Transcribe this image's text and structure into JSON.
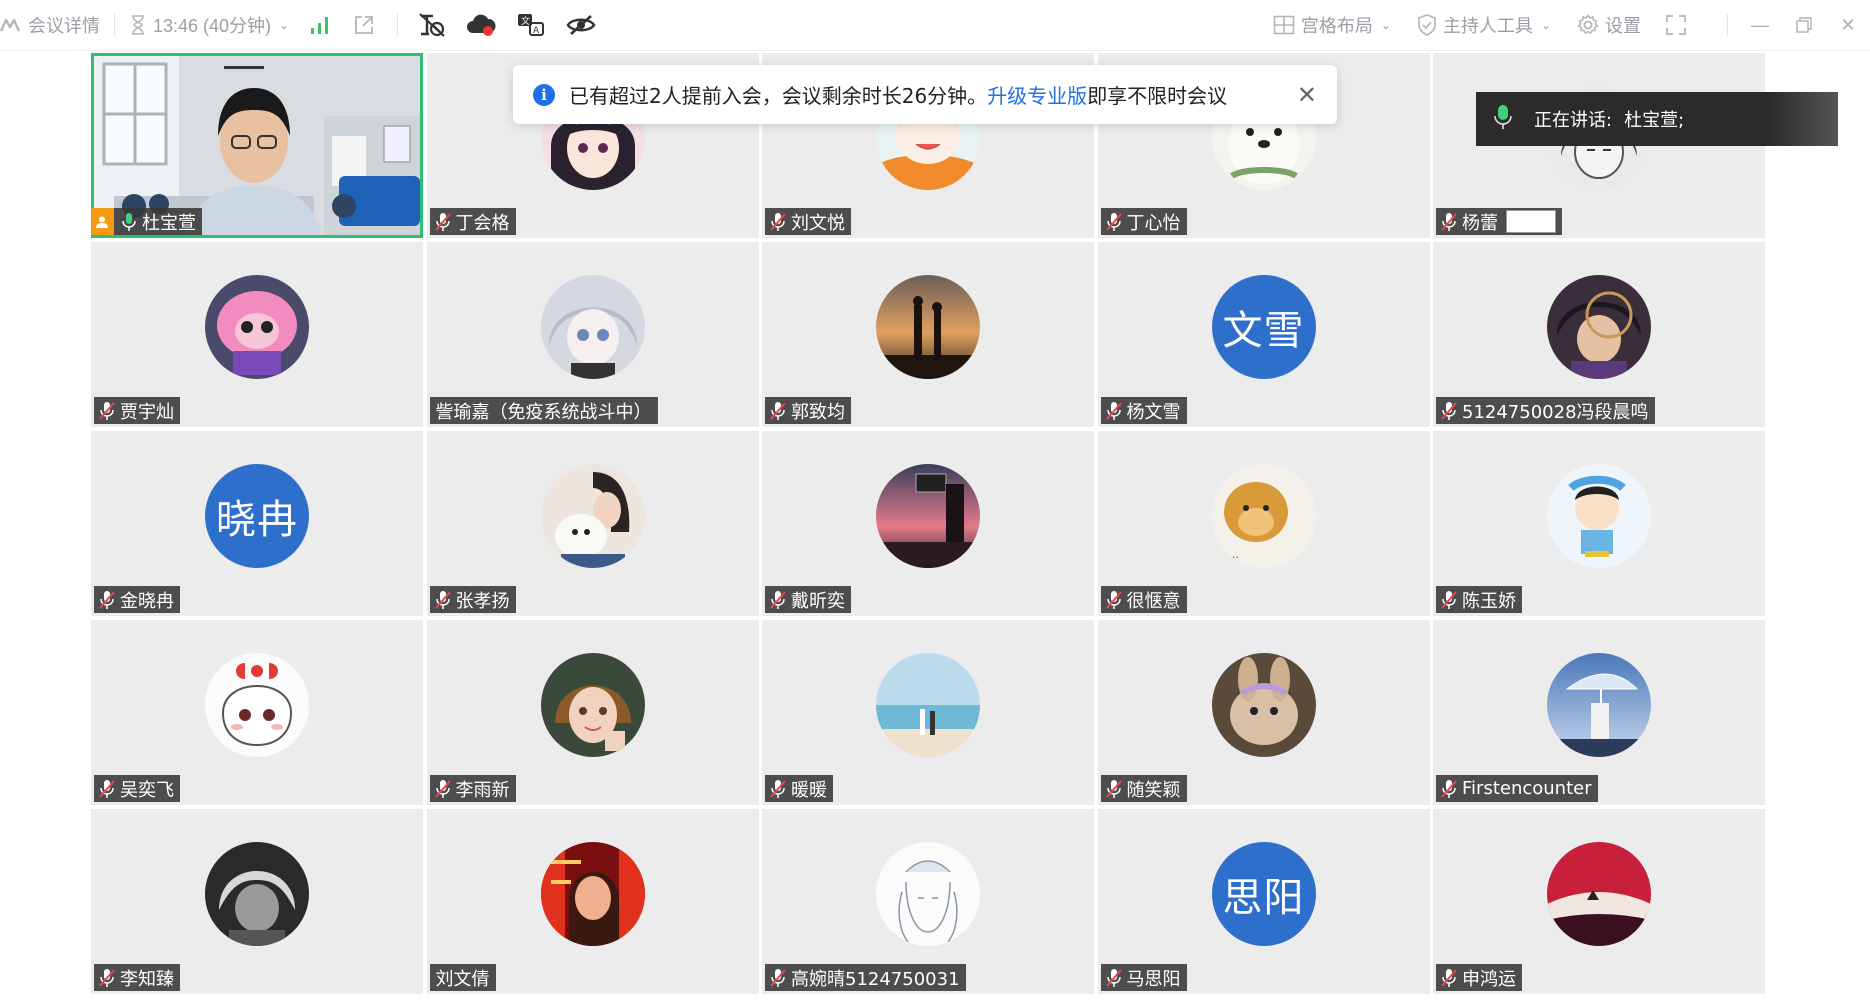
{
  "toolbar": {
    "meeting_details": "会议详情",
    "time": "13:46 (40分钟)",
    "layout": "宫格布局",
    "host_tools": "主持人工具",
    "settings": "设置"
  },
  "notice": {
    "text_before": "已有超过2人提前入会，会议剩余时长26分钟。",
    "link": "升级专业版",
    "text_after": "即享不限时会议"
  },
  "speaking": {
    "label": "正在讲话:",
    "name": "杜宝萱;"
  },
  "participants": [
    {
      "name": "杜宝萱",
      "host": true,
      "video": true
    },
    {
      "name": "丁会格",
      "avatar": "anime-girl"
    },
    {
      "name": "刘文悦",
      "avatar": "cartoon-orange"
    },
    {
      "name": "丁心怡",
      "avatar": "white-bear"
    },
    {
      "name": "杨蕾",
      "avatar": "sketch-portrait"
    },
    {
      "name": "贾宇灿",
      "avatar": "pink-sheep"
    },
    {
      "name": "訾瑜嘉（免疫系统战斗中）",
      "avatar": "anime-grey-hair"
    },
    {
      "name": "郭致均",
      "avatar": "sunset-couple"
    },
    {
      "name": "杨文雪",
      "avatar_text": "文雪"
    },
    {
      "name": "5124750028冯段晨鸣",
      "avatar": "anime-boy-hat"
    },
    {
      "name": "金晓冉",
      "avatar_text": "晓冉"
    },
    {
      "name": "张孝扬",
      "avatar": "girl-with-cat"
    },
    {
      "name": "戴昕奕",
      "avatar": "pink-sky-station"
    },
    {
      "name": "很惬意",
      "avatar": "doge"
    },
    {
      "name": "陈玉娇",
      "avatar": "crayon-shin-chan"
    },
    {
      "name": "吴奕飞",
      "avatar": "chibi-red-bow"
    },
    {
      "name": "李雨新",
      "avatar": "little-girl"
    },
    {
      "name": "暖暖",
      "avatar": "beach-couple"
    },
    {
      "name": "随笑颖",
      "avatar": "rabbit"
    },
    {
      "name": "Firstencounter",
      "avatar": "umbrella-girl"
    },
    {
      "name": "李知臻",
      "avatar": "bw-anime"
    },
    {
      "name": "刘文倩",
      "avatar": "red-light-girl",
      "no_mic": true
    },
    {
      "name": "高婉晴5124750031",
      "avatar": "line-drawing-girl"
    },
    {
      "name": "马思阳",
      "avatar_text": "思阳"
    },
    {
      "name": "申鸿运",
      "avatar": "red-landscape"
    }
  ]
}
